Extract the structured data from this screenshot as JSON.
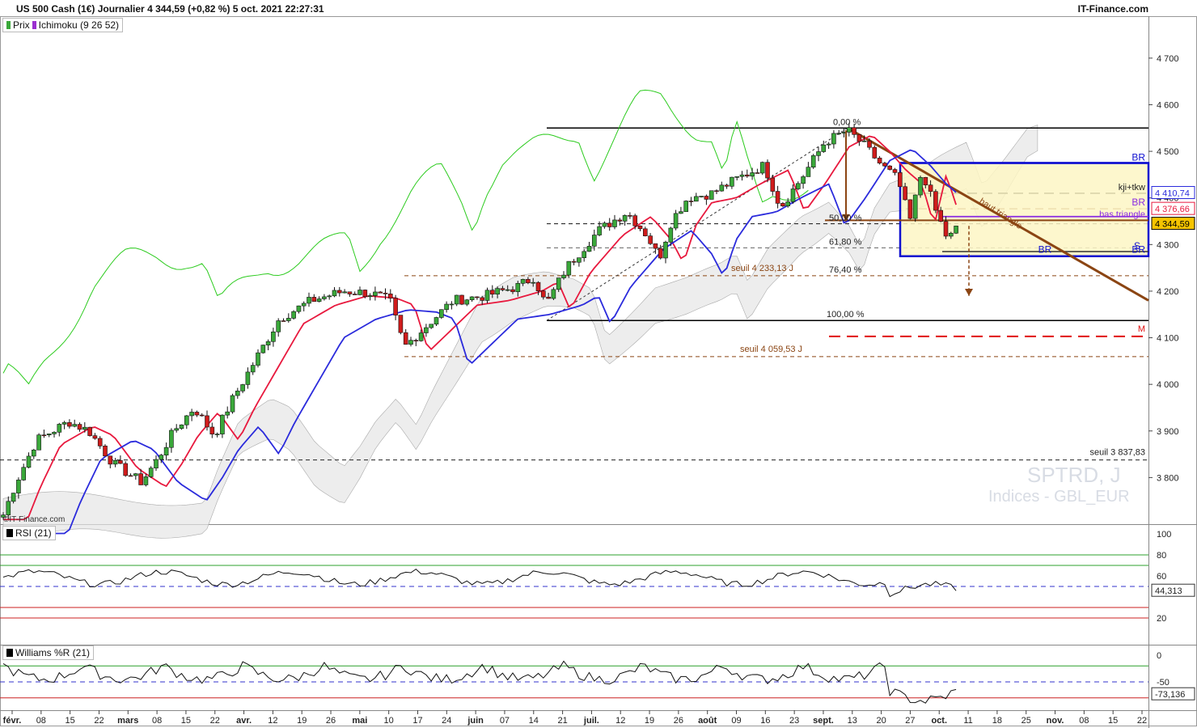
{
  "header": {
    "title": "US 500 Cash (1€) Journalier 4 344,59 (+0,82 %) 5 oct. 2021 22:27:31",
    "brand": "IT-Finance.com",
    "credit": "©IT-Finance.com"
  },
  "legends": {
    "price": "Prix",
    "ichimoku": "Ichimoku (9 26 52)",
    "rsi": "RSI (21)",
    "williams": "Williams %R (21)"
  },
  "watermark": {
    "symbol": "SPTRD, J",
    "sub": "Indices - GBL_EUR"
  },
  "colors": {
    "up": "#3aa83a",
    "down": "#d01c1c",
    "tenkan": "#e8193e",
    "kijun": "#2b2bdc",
    "chikou": "#2ccb1e",
    "trend": "#8b4513",
    "box": "#1010d0",
    "zone": "#fdf6c4"
  },
  "chart_data": {
    "type": "candlestick",
    "price_axis": {
      "min": 3700,
      "max": 4790,
      "ticks": [
        3800,
        3900,
        4000,
        4100,
        4200,
        4300,
        4400,
        4500,
        4600,
        4700
      ],
      "tick_labels": [
        "3 800",
        "3 900",
        "4 000",
        "4 100",
        "4 200",
        "4 300",
        "4 400",
        "4 500",
        "4 600",
        "4 700"
      ]
    },
    "time_axis": {
      "labels": [
        "févr.",
        "08",
        "15",
        "22",
        "mars",
        "08",
        "15",
        "22",
        "avr.",
        "12",
        "19",
        "26",
        "mai",
        "10",
        "17",
        "24",
        "juin",
        "07",
        "14",
        "21",
        "juil.",
        "12",
        "19",
        "26",
        "août",
        "09",
        "16",
        "23",
        "sept.",
        "13",
        "20",
        "27",
        "oct.",
        "11",
        "18",
        "25",
        "nov.",
        "08",
        "15",
        "22"
      ],
      "bold": [
        "févr.",
        "mars",
        "avr.",
        "mai",
        "juin",
        "juil.",
        "août",
        "sept.",
        "oct.",
        "nov."
      ]
    },
    "last_price": "4 344,59",
    "price_badges": [
      {
        "label": "4 410,74",
        "value": 4410.74,
        "color": "#2b2bdc"
      },
      {
        "label": "4 376,66",
        "value": 4376.66,
        "color": "#e8193e"
      },
      {
        "label": "4 344,59",
        "value": 4344.59,
        "color": "#000000"
      }
    ],
    "fibonacci": [
      {
        "label": "0,00 %",
        "value": 4550
      },
      {
        "label": "50,00 %",
        "value": 4344
      },
      {
        "label": "61,80 %",
        "value": 4293
      },
      {
        "label": "76,40 %",
        "value": 4233
      },
      {
        "label": "100,00 %",
        "value": 4137
      }
    ],
    "levels": [
      {
        "label": "seuil 4 233,13 J",
        "value": 4233.13
      },
      {
        "label": "seuil 4 059,53 J",
        "value": 4059.53
      },
      {
        "label": "seuil 3 837,83",
        "value": 3837.83
      },
      {
        "label": "kji+tkw",
        "value": 4410
      },
      {
        "label": "bas triangle",
        "value": 4352
      },
      {
        "label": "M",
        "value": 4103
      }
    ],
    "markers": [
      "BR",
      "BR",
      "S",
      "BR",
      "BR"
    ],
    "trendline_label": "haut triangle",
    "rsi": {
      "axis_ticks": [
        100,
        80,
        60,
        20
      ],
      "last": "44,313",
      "levels": [
        70,
        50,
        30
      ]
    },
    "williams": {
      "axis_ticks": [
        0,
        -50
      ],
      "last": "-73,136",
      "levels": [
        -20,
        -50,
        -80
      ]
    }
  }
}
